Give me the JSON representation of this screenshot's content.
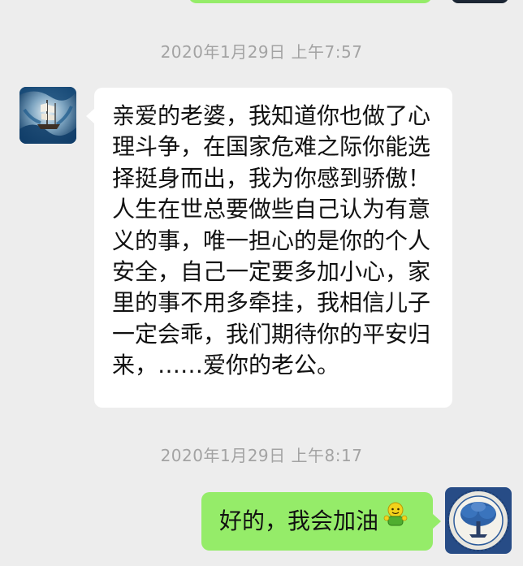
{
  "chat": {
    "messages": [
      {
        "timestamp": "2020年1月29日 上午7:57",
        "direction": "incoming",
        "text": "亲爱的老婆，我知道你也做了心理斗争，在国家危难之际你能选择挺身而出，我为你感到骄傲！人生在世总要做些自己认为有意义的事，唯一担心的是你的个人安全，自己一定要多加小心，家里的事不用多牵挂，我相信儿子一定会乖，我们期待你的平安归来，……爱你的老公。",
        "avatar_icon": "sailboat-avatar-icon"
      },
      {
        "timestamp": "2020年1月29日 上午8:17",
        "direction": "outgoing",
        "text": "好的，我会加油",
        "emoji_icon": "cheer-emoji-icon",
        "avatar_icon": "tree-badge-avatar-icon"
      }
    ]
  },
  "colors": {
    "background": "#ededed",
    "incoming_bubble": "#ffffff",
    "outgoing_bubble": "#95ec69",
    "timestamp_text": "#a3a3a3",
    "message_text": "#111111"
  }
}
